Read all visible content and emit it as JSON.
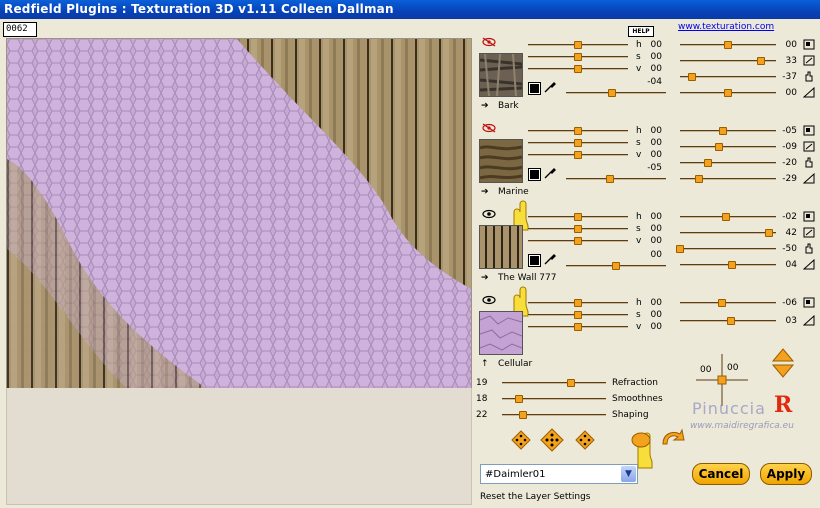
{
  "window": {
    "title": "Redfield Plugins : Texturation 3D v1.11    Colleen Dallman"
  },
  "frame_counter": "0062",
  "help_label": "HELP",
  "website": "www.texturation.com",
  "layers": [
    {
      "name": "Bark",
      "visible": false,
      "h_label": "h",
      "s_label": "s",
      "v_label": "v",
      "h_value": "00",
      "s_value": "00",
      "v_value": "00",
      "extra_value": "-04",
      "r1": "00",
      "r2": "33",
      "r3": "-37",
      "r4": "00"
    },
    {
      "name": "Marine",
      "visible": false,
      "h_label": "h",
      "s_label": "s",
      "v_label": "v",
      "h_value": "00",
      "s_value": "00",
      "v_value": "00",
      "extra_value": "-05",
      "r1": "-05",
      "r2": "-09",
      "r3": "-20",
      "r4": "-29"
    },
    {
      "name": "The Wall 777",
      "visible": true,
      "h_label": "h",
      "s_label": "s",
      "v_label": "v",
      "h_value": "00",
      "s_value": "00",
      "v_value": "00",
      "extra_value": "00",
      "r1": "-02",
      "r2": "42",
      "r3": "-50",
      "r4": "04"
    },
    {
      "name": "Cellular",
      "visible": true,
      "h_label": "h",
      "s_label": "s",
      "v_label": "v",
      "h_value": "00",
      "s_value": "00",
      "v_value": "00",
      "r1": "-06",
      "r2": "03"
    }
  ],
  "settings": {
    "refraction": {
      "label": "Refraction",
      "value": "19"
    },
    "smoothness": {
      "label": "Smoothnes",
      "value": "18"
    },
    "shaping": {
      "label": "Shaping",
      "value": "22"
    }
  },
  "crosshair": {
    "x_value": "00",
    "y_value": "00"
  },
  "watermark": {
    "name": "Pinuccia",
    "url": "www.maidiregrafica.eu"
  },
  "preset": {
    "value": "#Daimler01"
  },
  "status": "Reset the Layer Settings",
  "buttons": {
    "cancel": "Cancel",
    "apply": "Apply"
  }
}
